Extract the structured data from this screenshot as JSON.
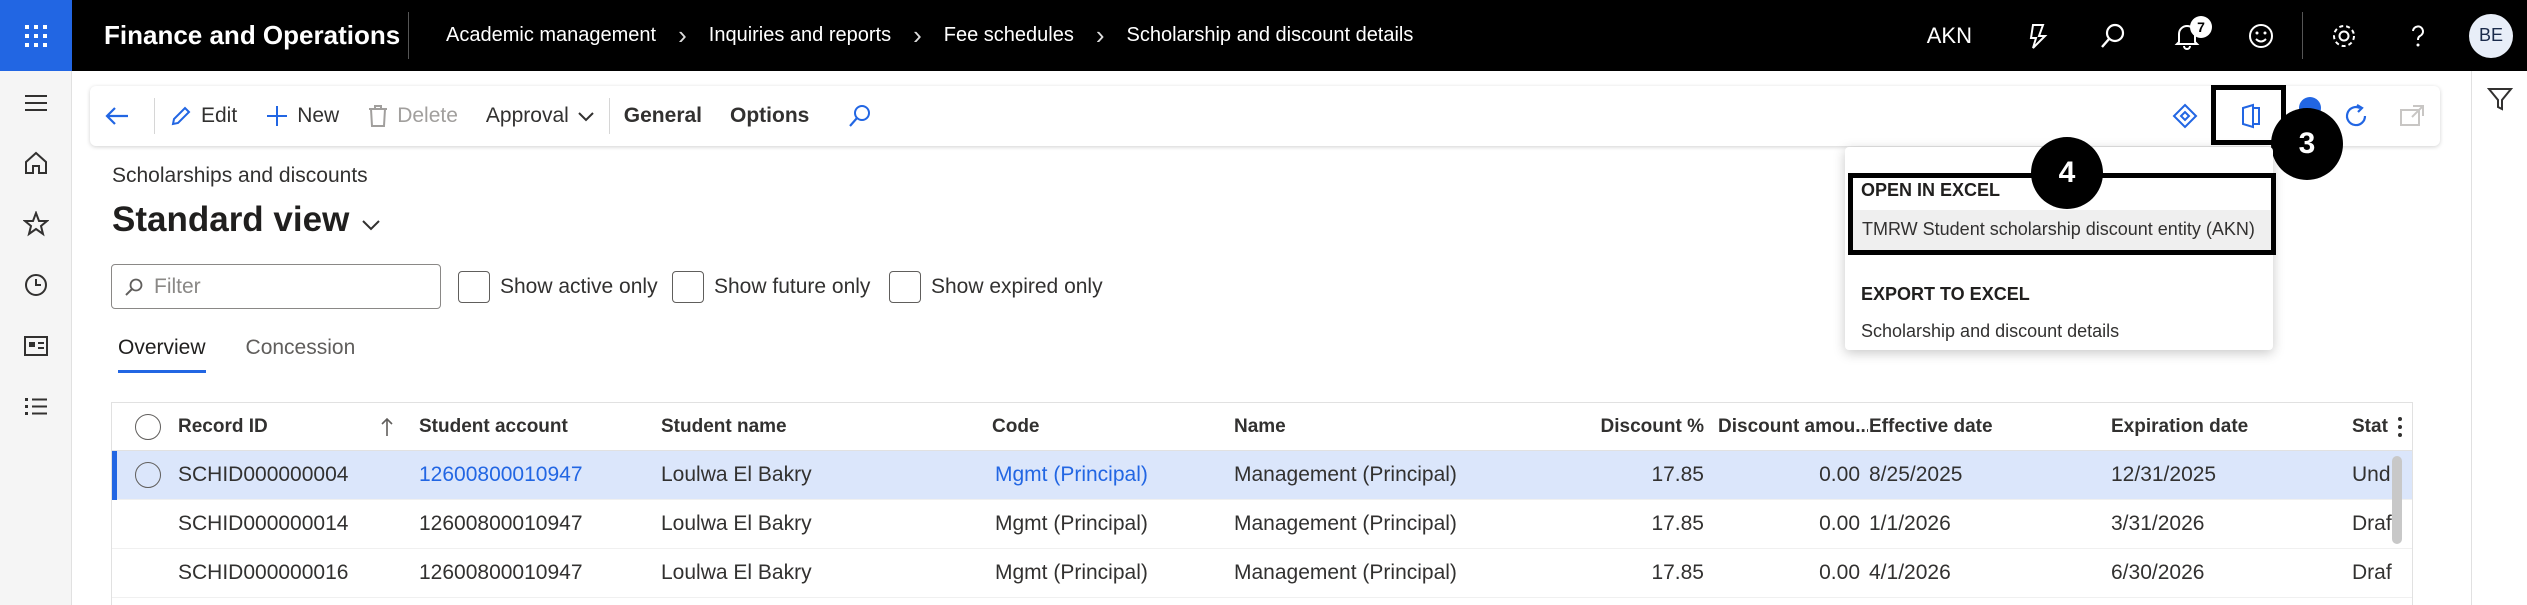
{
  "topbar": {
    "app_title": "Finance and Operations",
    "breadcrumb": [
      "Academic management",
      "Inquiries and reports",
      "Fee schedules",
      "Scholarship and discount details"
    ],
    "company": "AKN",
    "notification_count": "7",
    "avatar_initials": "BE",
    "icons": [
      "waffle-icon",
      "copilot-icon",
      "search-icon",
      "bell-icon",
      "smiley-icon",
      "gear-icon",
      "help-icon"
    ]
  },
  "leftrail": {
    "icons": [
      "hamburger-icon",
      "home-icon",
      "star-icon",
      "clock-icon",
      "workspace-icon",
      "list-icon"
    ]
  },
  "actionpane": {
    "edit": "Edit",
    "new": "New",
    "delete": "Delete",
    "approval": "Approval",
    "general": "General",
    "options": "Options"
  },
  "callouts": {
    "step3": "3",
    "step4": "4"
  },
  "page": {
    "caption": "Scholarships and discounts",
    "view_name": "Standard view",
    "filter_placeholder": "Filter",
    "checkboxes": [
      "Show active only",
      "Show future only",
      "Show expired only"
    ],
    "tabs": [
      "Overview",
      "Concession"
    ]
  },
  "grid": {
    "columns": [
      "Record ID",
      "Student account",
      "Student name",
      "Code",
      "Name",
      "Discount %",
      "Discount amou...",
      "Effective date",
      "Expiration date",
      "Stat"
    ],
    "rows": [
      [
        "SCHID000000004",
        "12600800010947",
        "Loulwa El Bakry",
        "Mgmt (Principal)",
        "Management (Principal)",
        "17.85",
        "0.00",
        "8/25/2025",
        "12/31/2025",
        "Und"
      ],
      [
        "SCHID000000014",
        "12600800010947",
        "Loulwa El Bakry",
        "Mgmt (Principal)",
        "Management (Principal)",
        "17.85",
        "0.00",
        "1/1/2026",
        "3/31/2026",
        "Draf"
      ],
      [
        "SCHID000000016",
        "12600800010947",
        "Loulwa El Bakry",
        "Mgmt (Principal)",
        "Management (Principal)",
        "17.85",
        "0.00",
        "4/1/2026",
        "6/30/2026",
        "Draf"
      ]
    ]
  },
  "excel_menu": {
    "open_header": "OPEN IN EXCEL",
    "open_item": "TMRW Student scholarship discount entity (AKN)",
    "export_header": "EXPORT TO EXCEL",
    "export_item": "Scholarship and discount details"
  },
  "colors": {
    "accent": "#2266e3",
    "topbar": "#000000",
    "selected_row": "#dbe6fb"
  }
}
